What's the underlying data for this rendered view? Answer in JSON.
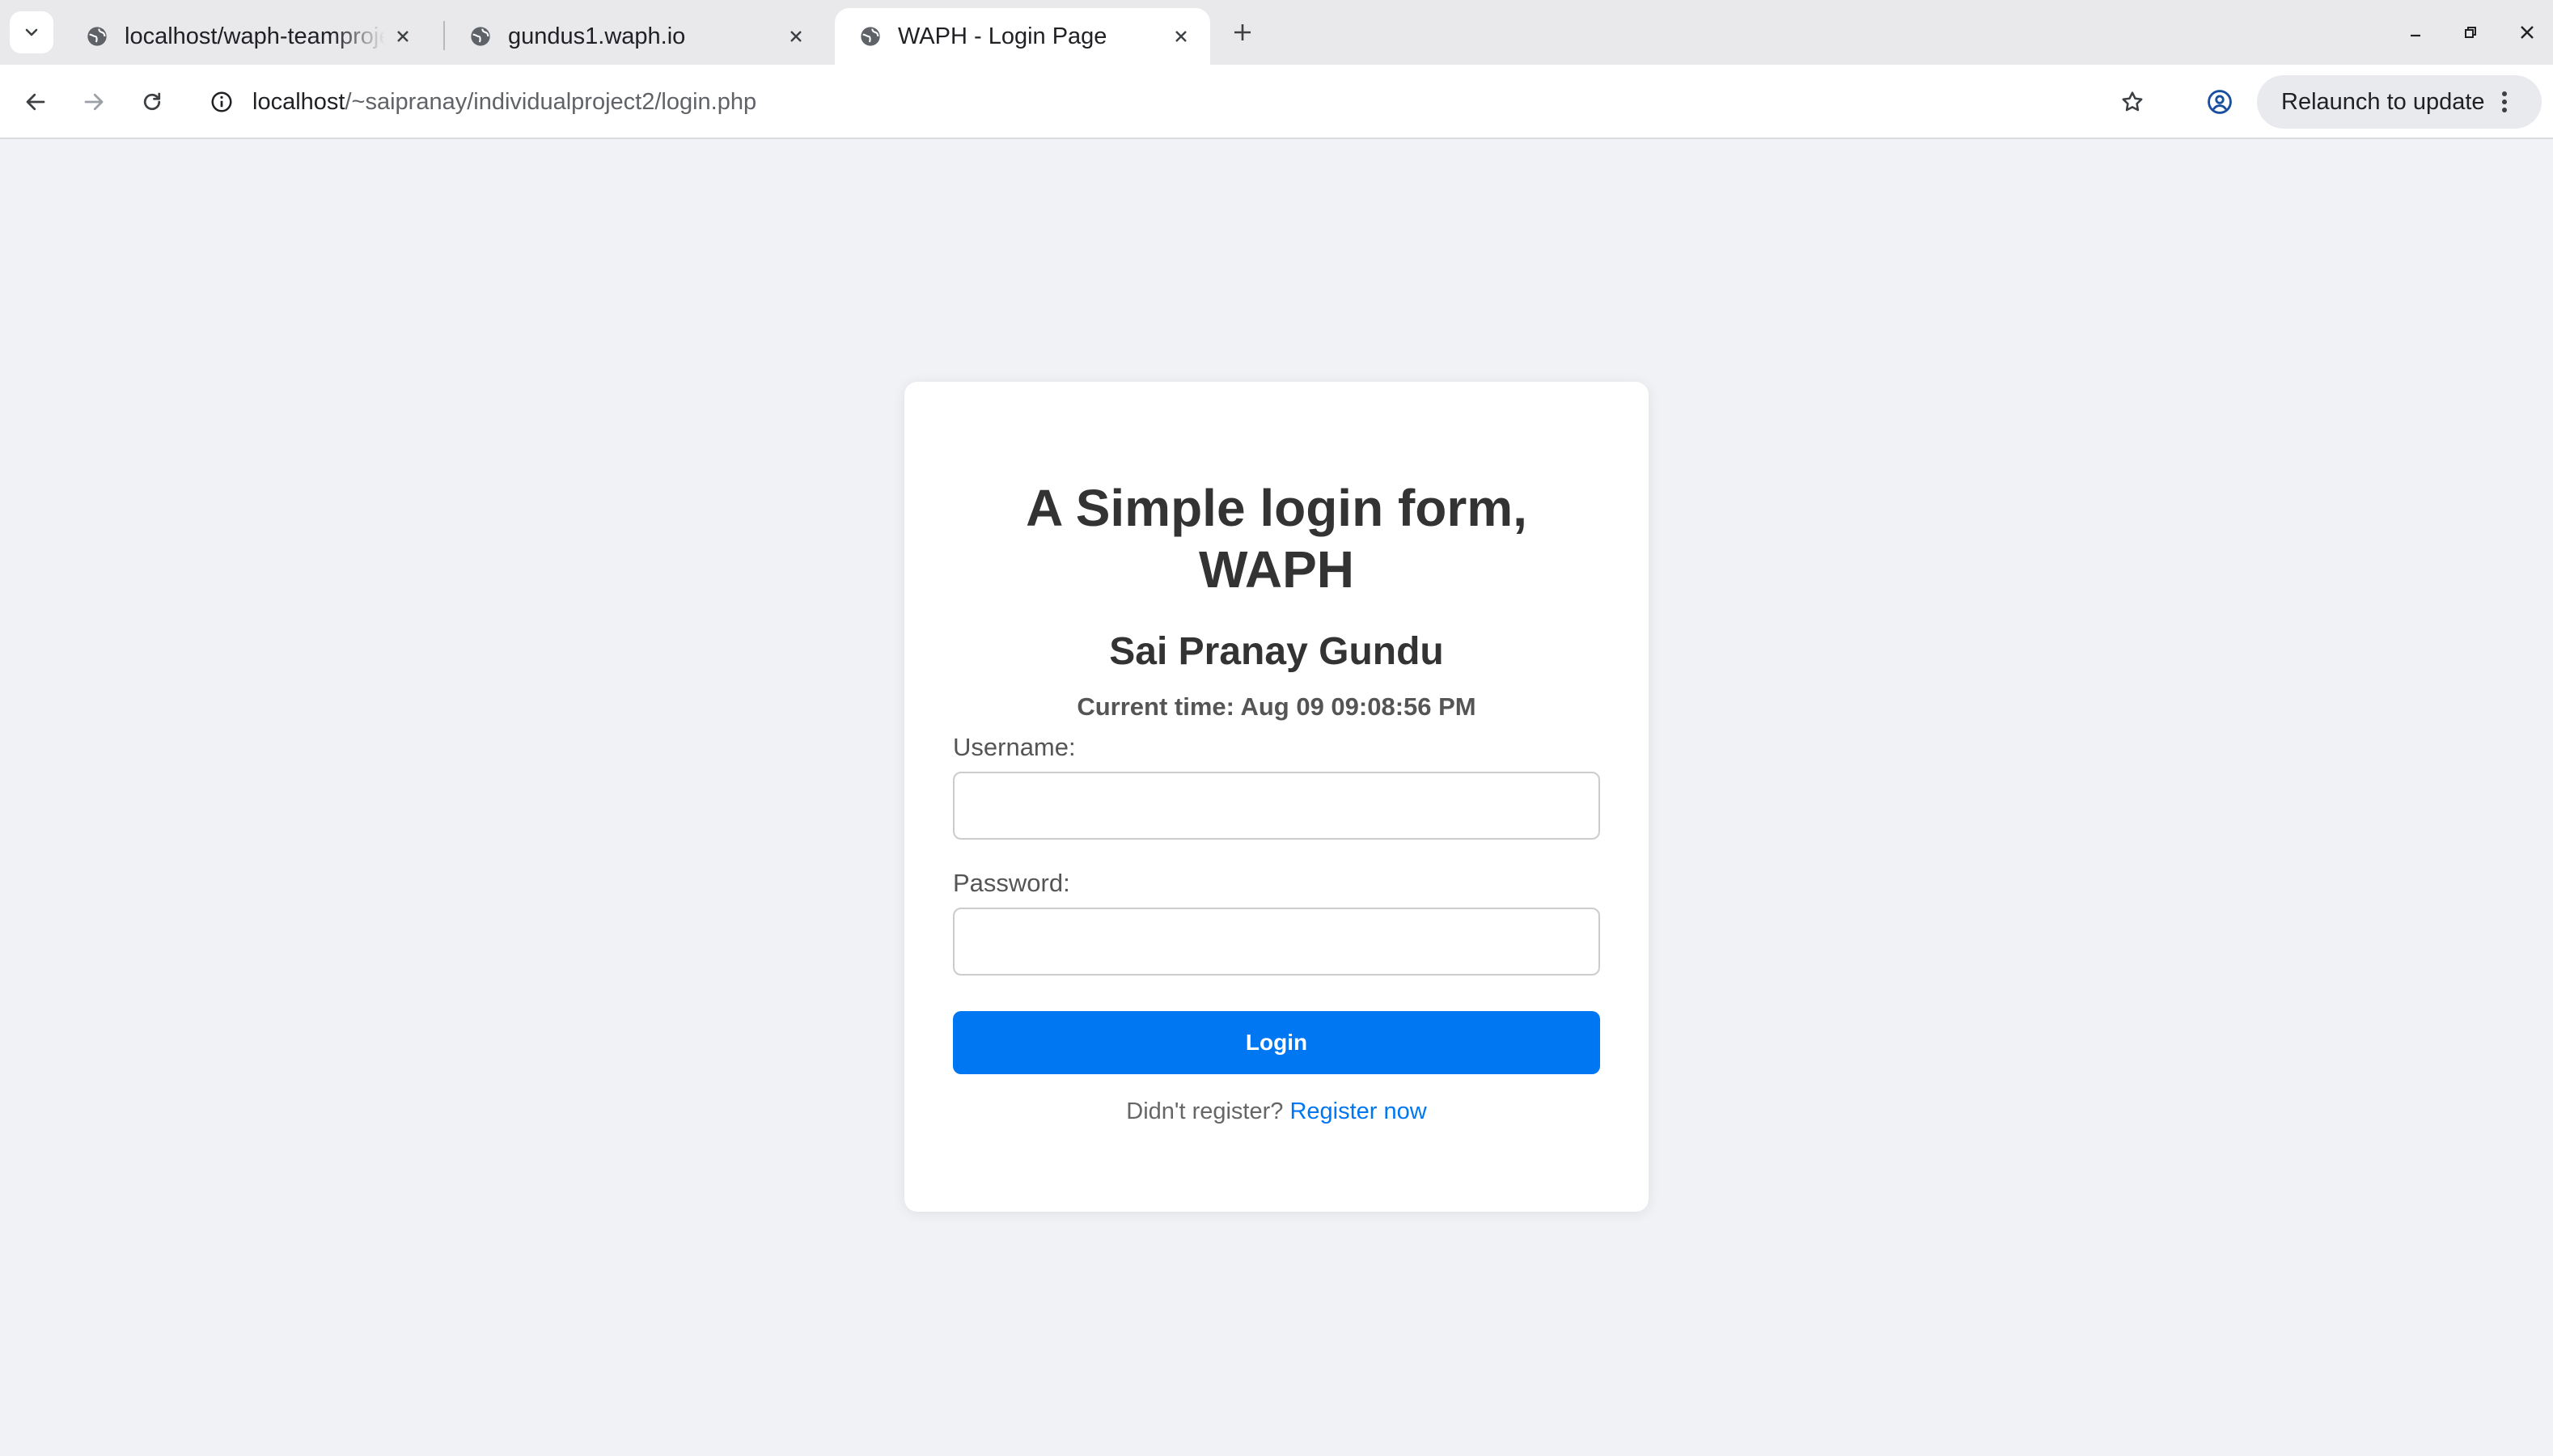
{
  "browser": {
    "tabs": [
      {
        "title": "localhost/waph-teamproject",
        "active": false
      },
      {
        "title": "gundus1.waph.io",
        "active": false
      },
      {
        "title": "WAPH - Login Page",
        "active": true
      }
    ],
    "address": {
      "host": "localhost",
      "path": "/~saipranay/individualproject2/login.php"
    },
    "relaunch_label": "Relaunch to update"
  },
  "page": {
    "title": "A Simple login form, WAPH",
    "author": "Sai Pranay Gundu",
    "current_time": "Current time: Aug 09 09:08:56 PM",
    "form": {
      "username_label": "Username:",
      "username_value": "",
      "password_label": "Password:",
      "password_value": "",
      "submit_label": "Login"
    },
    "register_prompt": "Didn't register?",
    "register_link": "Register now"
  },
  "colors": {
    "accent": "#0077f2",
    "page_background": "#f0f2f5",
    "card_background": "#ffffff"
  },
  "icons": [
    "tab-search-icon",
    "globe-icon",
    "close-icon",
    "plus-icon",
    "minimize-icon",
    "restore-icon",
    "window-close-icon",
    "back-icon",
    "forward-icon",
    "reload-icon",
    "info-icon",
    "star-icon",
    "profile-icon",
    "kebab-icon"
  ]
}
